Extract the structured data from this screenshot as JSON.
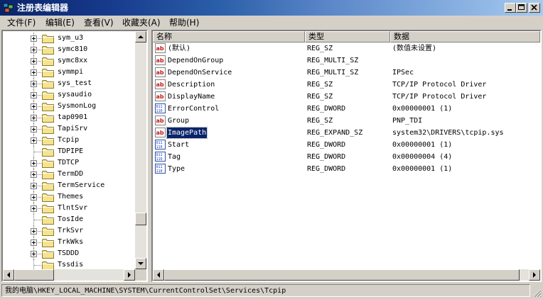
{
  "window": {
    "title": "注册表编辑器",
    "controls": {
      "minimize": "minimize-icon",
      "maximize": "maximize-icon",
      "close": "close-icon"
    }
  },
  "menu": [
    "文件(F)",
    "编辑(E)",
    "查看(V)",
    "收藏夹(A)",
    "帮助(H)"
  ],
  "tree": [
    {
      "label": "sym_u3",
      "expandable": true
    },
    {
      "label": "symc810",
      "expandable": true
    },
    {
      "label": "symc8xx",
      "expandable": true
    },
    {
      "label": "symmpi",
      "expandable": true
    },
    {
      "label": "sys_test",
      "expandable": true
    },
    {
      "label": "sysaudio",
      "expandable": true
    },
    {
      "label": "SysmonLog",
      "expandable": true
    },
    {
      "label": "tap0901",
      "expandable": true
    },
    {
      "label": "TapiSrv",
      "expandable": true
    },
    {
      "label": "Tcpip",
      "expandable": true
    },
    {
      "label": "TDPIPE",
      "expandable": false
    },
    {
      "label": "TDTCP",
      "expandable": true
    },
    {
      "label": "TermDD",
      "expandable": true
    },
    {
      "label": "TermService",
      "expandable": true
    },
    {
      "label": "Themes",
      "expandable": true
    },
    {
      "label": "TlntSvr",
      "expandable": true
    },
    {
      "label": "TosIde",
      "expandable": false
    },
    {
      "label": "TrkSvr",
      "expandable": true
    },
    {
      "label": "TrkWks",
      "expandable": true
    },
    {
      "label": "TSDDD",
      "expandable": true
    },
    {
      "label": "Tssdis",
      "expandable": false
    }
  ],
  "columns": {
    "name": "名称",
    "type": "类型",
    "data": "数据"
  },
  "values": [
    {
      "icon": "string-value-icon",
      "name": "(默认)",
      "type": "REG_SZ",
      "data": "(数值未设置)"
    },
    {
      "icon": "string-value-icon",
      "name": "DependOnGroup",
      "type": "REG_MULTI_SZ",
      "data": ""
    },
    {
      "icon": "string-value-icon",
      "name": "DependOnService",
      "type": "REG_MULTI_SZ",
      "data": "IPSec"
    },
    {
      "icon": "string-value-icon",
      "name": "Description",
      "type": "REG_SZ",
      "data": "TCP/IP Protocol Driver"
    },
    {
      "icon": "string-value-icon",
      "name": "DisplayName",
      "type": "REG_SZ",
      "data": "TCP/IP Protocol Driver"
    },
    {
      "icon": "dword-value-icon",
      "name": "ErrorControl",
      "type": "REG_DWORD",
      "data": "0x00000001 (1)"
    },
    {
      "icon": "string-value-icon",
      "name": "Group",
      "type": "REG_SZ",
      "data": "PNP_TDI"
    },
    {
      "icon": "string-value-icon",
      "name": "ImagePath",
      "type": "REG_EXPAND_SZ",
      "data": "system32\\DRIVERS\\tcpip.sys",
      "selected": true
    },
    {
      "icon": "dword-value-icon",
      "name": "Start",
      "type": "REG_DWORD",
      "data": "0x00000001 (1)"
    },
    {
      "icon": "dword-value-icon",
      "name": "Tag",
      "type": "REG_DWORD",
      "data": "0x00000004 (4)"
    },
    {
      "icon": "dword-value-icon",
      "name": "Type",
      "type": "REG_DWORD",
      "data": "0x00000001 (1)"
    }
  ],
  "status": {
    "path": "我的电脑\\HKEY_LOCAL_MACHINE\\SYSTEM\\CurrentControlSet\\Services\\Tcpip"
  },
  "colors": {
    "selection": "#0a246a",
    "face": "#d4d0c8",
    "folder": "#f5e38e"
  }
}
